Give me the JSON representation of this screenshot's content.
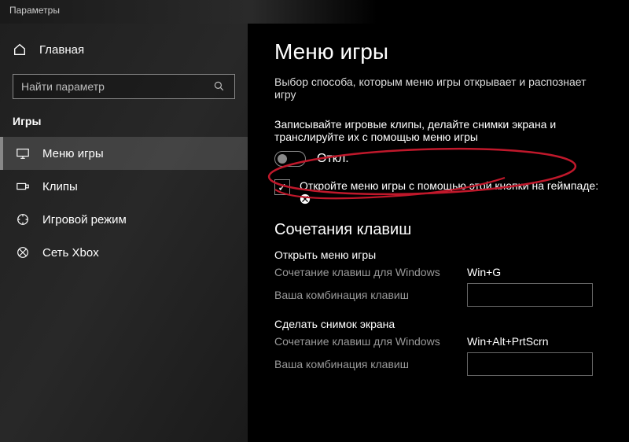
{
  "window": {
    "title": "Параметры"
  },
  "sidebar": {
    "home": "Главная",
    "search_placeholder": "Найти параметр",
    "category": "Игры",
    "items": [
      {
        "label": "Меню игры"
      },
      {
        "label": "Клипы"
      },
      {
        "label": "Игровой режим"
      },
      {
        "label": "Сеть Xbox"
      }
    ]
  },
  "content": {
    "heading": "Меню игры",
    "description": "Выбор способа, которым меню игры открывает и распознает игру",
    "record_setting_label": "Записывайте игровые клипы, делайте снимки экрана и транслируйте их с помощью меню игры",
    "toggle_state": "Откл.",
    "checkbox_label": "Откройте меню игры с помощью этой кнопки на геймпаде:",
    "shortcuts_heading": "Сочетания клавиш",
    "shortcut_windows_label": "Сочетание клавиш для Windows",
    "shortcut_custom_label": "Ваша комбинация клавиш",
    "groups": [
      {
        "title": "Открыть меню игры",
        "windows_value": "Win+G"
      },
      {
        "title": "Сделать снимок экрана",
        "windows_value": "Win+Alt+PrtScrn"
      }
    ]
  }
}
